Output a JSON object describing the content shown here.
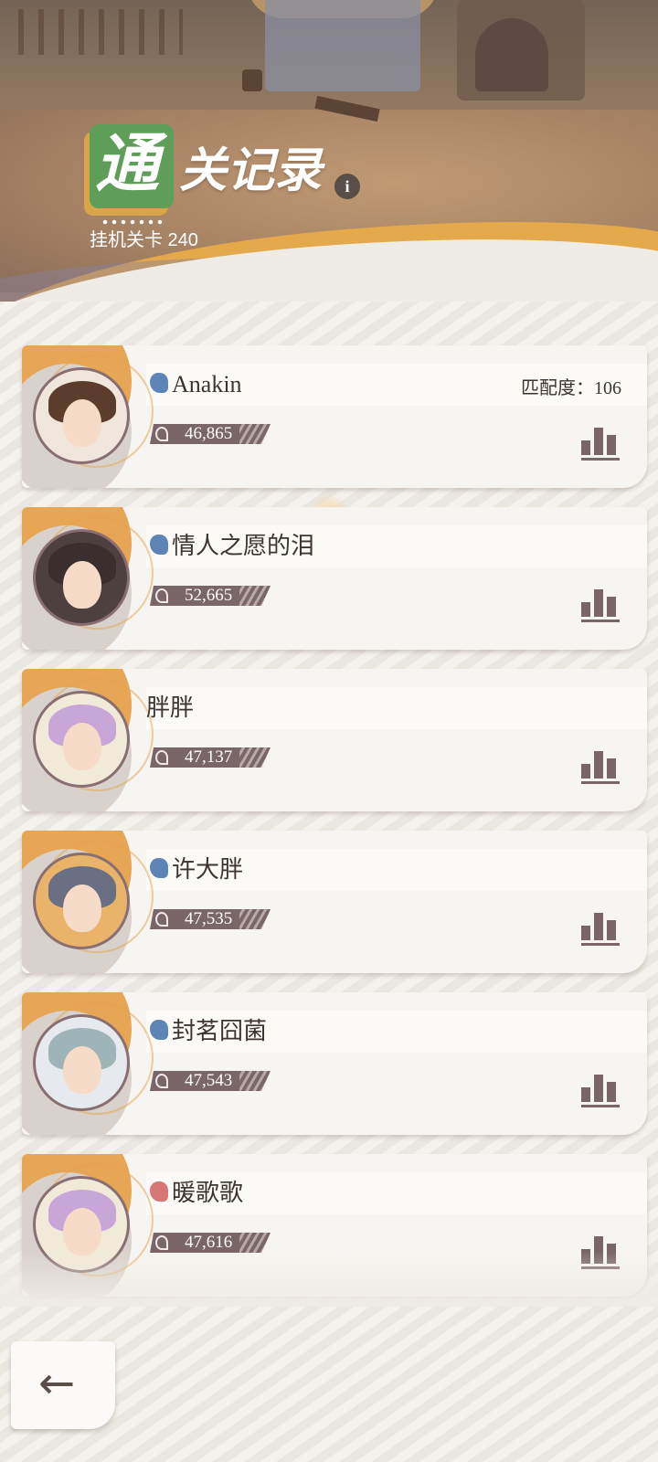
{
  "header": {
    "title_badge": "通",
    "title_rest": "关记录",
    "info_glyph": "i",
    "subtitle": "挂机关卡 240"
  },
  "records": [
    {
      "name": "Anakin",
      "gender": "male",
      "power": "46,865",
      "match_text": "匹配度：106",
      "avatar_hair": "#5c3c2c",
      "avatar_bg": "#f1e6dc"
    },
    {
      "name": "情人之愿的泪",
      "gender": "male",
      "power": "52,665",
      "match_text": "",
      "avatar_hair": "#3a2f2e",
      "avatar_bg": "#4d403f"
    },
    {
      "name": "胖胖",
      "gender": "",
      "power": "47,137",
      "match_text": "",
      "avatar_hair": "#c9a6d8",
      "avatar_bg": "#f2ead8"
    },
    {
      "name": "许大胖",
      "gender": "male",
      "power": "47,535",
      "match_text": "",
      "avatar_hair": "#6a6f84",
      "avatar_bg": "#e9b46a"
    },
    {
      "name": "封茗囧菌",
      "gender": "male",
      "power": "47,543",
      "match_text": "",
      "avatar_hair": "#9fb4b6",
      "avatar_bg": "#e6eaee"
    },
    {
      "name": "暖歌歌",
      "gender": "female",
      "power": "47,616",
      "match_text": "",
      "avatar_hair": "#c9a6d8",
      "avatar_bg": "#f2ead8"
    }
  ],
  "icons": {
    "stats": "bar-chart-icon",
    "power": "power-icon",
    "back": "back-arrow-icon"
  },
  "back_button": {
    "glyph": "←"
  },
  "colors": {
    "accent_orange": "#e5a14c",
    "badge_green": "#5e9e58",
    "male_blue": "#5d84b6",
    "female_red": "#d87575",
    "power_bar": "#7a6668"
  }
}
